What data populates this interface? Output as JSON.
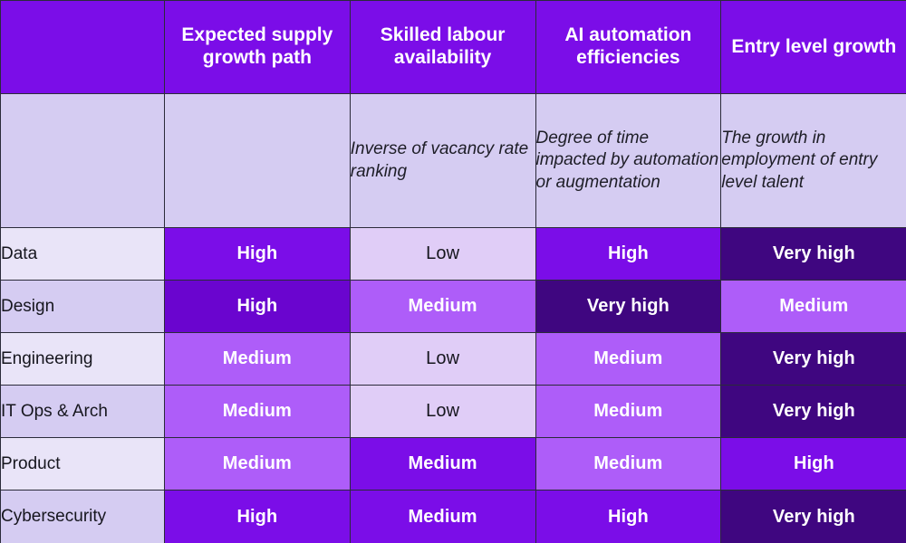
{
  "table": {
    "corner_label": "",
    "columns": [
      {
        "key": "supply",
        "header": "Expected supply growth path",
        "description": ""
      },
      {
        "key": "skilled",
        "header": "Skilled labour availability",
        "description": "Inverse of vacancy rate ranking"
      },
      {
        "key": "ai",
        "header": "AI automation efficiencies",
        "description": "Degree of time impacted by automation or augmentation"
      },
      {
        "key": "entry",
        "header": "Entry level growth",
        "description": "The growth in employment of entry level talent"
      }
    ],
    "rows": [
      {
        "label": "Data",
        "cells": [
          {
            "value": "High",
            "level": "high"
          },
          {
            "value": "Low",
            "level": "low"
          },
          {
            "value": "High",
            "level": "high"
          },
          {
            "value": "Very high",
            "level": "veryhigh"
          }
        ]
      },
      {
        "label": "Design",
        "cells": [
          {
            "value": "High",
            "level": "high-d"
          },
          {
            "value": "Medium",
            "level": "medium"
          },
          {
            "value": "Very high",
            "level": "veryhigh"
          },
          {
            "value": "Medium",
            "level": "medium"
          }
        ]
      },
      {
        "label": "Engineering",
        "cells": [
          {
            "value": "Medium",
            "level": "medium"
          },
          {
            "value": "Low",
            "level": "low"
          },
          {
            "value": "Medium",
            "level": "medium"
          },
          {
            "value": "Very high",
            "level": "veryhigh"
          }
        ]
      },
      {
        "label": "IT Ops & Arch",
        "cells": [
          {
            "value": "Medium",
            "level": "medium"
          },
          {
            "value": "Low",
            "level": "low"
          },
          {
            "value": "Medium",
            "level": "medium"
          },
          {
            "value": "Very high",
            "level": "veryhigh"
          }
        ]
      },
      {
        "label": "Product",
        "cells": [
          {
            "value": "Medium",
            "level": "medium"
          },
          {
            "value": "Medium",
            "level": "medium-d"
          },
          {
            "value": "Medium",
            "level": "medium"
          },
          {
            "value": "High",
            "level": "high"
          }
        ]
      },
      {
        "label": "Cybersecurity",
        "cells": [
          {
            "value": "High",
            "level": "high"
          },
          {
            "value": "Medium",
            "level": "medium-d"
          },
          {
            "value": "High",
            "level": "high"
          },
          {
            "value": "Very high",
            "level": "veryhigh"
          }
        ]
      }
    ]
  },
  "colors": {
    "header_purple": "#7B0DE8",
    "description_lavender": "#D5CCF2",
    "row_label_light": "#E9E4F8",
    "row_label_dark": "#D5CCF2",
    "level_low": "#E0CDF7",
    "level_medium": "#AE5DF9",
    "level_medium_dark": "#7B0DE8",
    "level_high": "#7B0DE8",
    "level_very_high": "#3F0680",
    "grid_line": "#2b2b3a",
    "text_dark": "#16161e",
    "text_light": "#FFFFFF"
  }
}
